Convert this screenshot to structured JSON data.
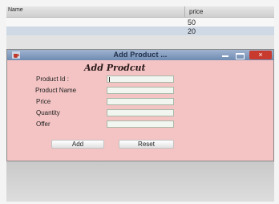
{
  "background_table": {
    "headers": [
      "Name",
      "price"
    ],
    "rows": [
      {
        "price": "50"
      },
      {
        "price": "20"
      }
    ]
  },
  "dialog": {
    "title": "Add Product ...",
    "close_label": "×",
    "form_title": "Add Prodcut",
    "fields": [
      {
        "label": "Product Id :",
        "value": ""
      },
      {
        "label": "Product Name",
        "value": ""
      },
      {
        "label": "Price",
        "value": ""
      },
      {
        "label": "Quantity",
        "value": ""
      },
      {
        "label": "Offer",
        "value": ""
      }
    ],
    "add_label": "Add",
    "reset_label": "Reset"
  },
  "colors": {
    "dialog_bg": "#f4c4c4",
    "titlebar": "#7f98bd",
    "close_button": "#c93a2e"
  },
  "icons": {
    "app_icon": "java-cup-icon",
    "minimize": "minimize-icon",
    "maximize": "maximize-icon",
    "close": "close-icon"
  }
}
